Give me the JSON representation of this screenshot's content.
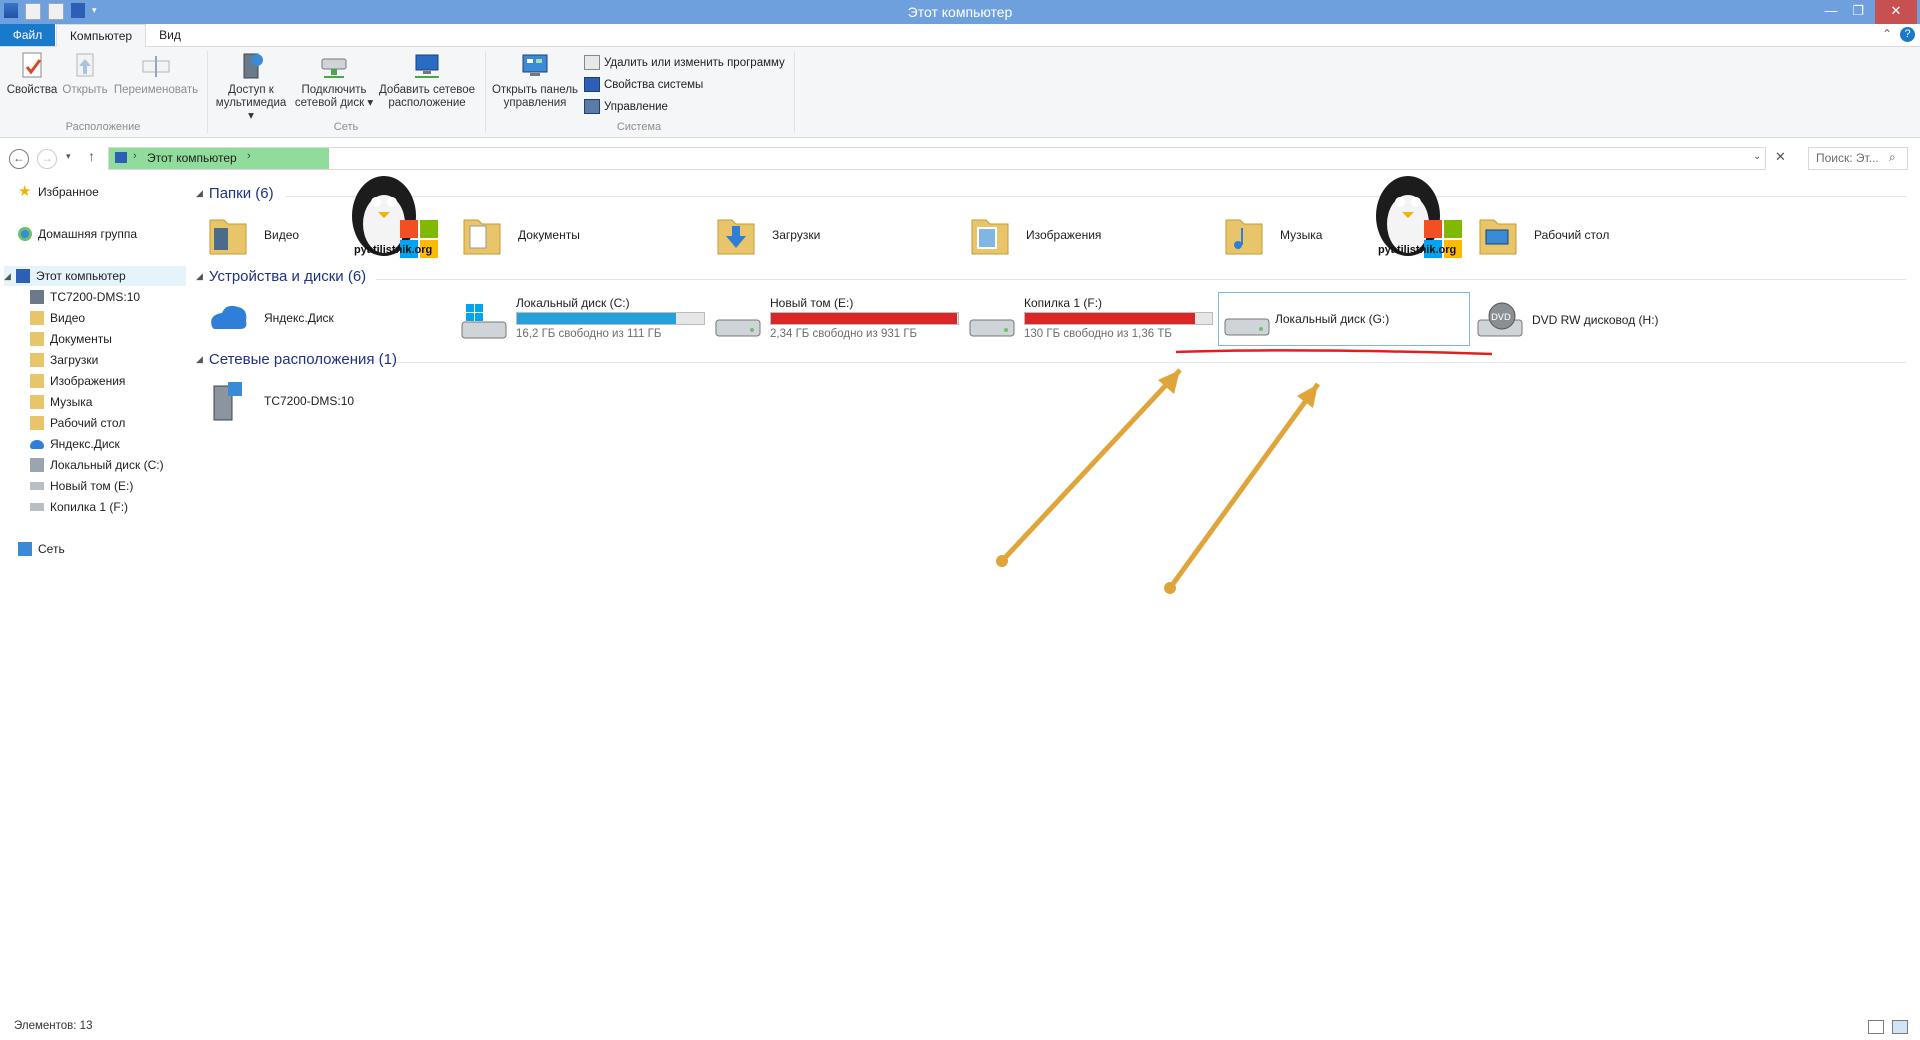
{
  "window": {
    "title": "Этот компьютер"
  },
  "ribbon": {
    "tabs": [
      "Файл",
      "Компьютер",
      "Вид"
    ],
    "location": {
      "label": "Расположение",
      "properties": "Свойства",
      "open": "Открыть",
      "rename": "Переименовать"
    },
    "network": {
      "label": "Сеть",
      "media_line1": "Доступ к",
      "media_line2": "мультимедиа",
      "map_line1": "Подключить",
      "map_line2": "сетевой диск",
      "add_line1": "Добавить сетевое",
      "add_line2": "расположение"
    },
    "system": {
      "label": "Система",
      "control_line1": "Открыть панель",
      "control_line2": "управления",
      "uninstall": "Удалить или изменить программу",
      "sysprops": "Свойства системы",
      "manage": "Управление"
    }
  },
  "address": {
    "path": "Этот компьютер",
    "search_placeholder": "Поиск: Эт..."
  },
  "nav": {
    "favorites": "Избранное",
    "homegroup": "Домашняя группа",
    "this_pc": "Этот компьютер",
    "children": [
      "TC7200-DMS:10",
      "Видео",
      "Документы",
      "Загрузки",
      "Изображения",
      "Музыка",
      "Рабочий стол",
      "Яндекс.Диск",
      "Локальный диск (C:)",
      "Новый том (E:)",
      "Копилка 1 (F:)"
    ],
    "network": "Сеть"
  },
  "folders_section": "Папки (6)",
  "folders": [
    "Видео",
    "Документы",
    "Загрузки",
    "Изображения",
    "Музыка",
    "Рабочий стол"
  ],
  "devices_section": "Устройства и диски (6)",
  "devices": {
    "yandex": "Яндекс.Диск",
    "c": {
      "name": "Локальный диск (C:)",
      "free": "16,2 ГБ свободно из 111 ГБ",
      "used_fraction": 0.85
    },
    "e": {
      "name": "Новый том (E:)",
      "free": "2,34 ГБ свободно из 931 ГБ",
      "used_fraction": 0.997
    },
    "f": {
      "name": "Копилка 1 (F:)",
      "free": "130 ГБ свободно из 1,36 ТБ",
      "used_fraction": 0.91
    },
    "g": {
      "name": "Локальный диск (G:)"
    },
    "h": {
      "name": "DVD RW дисковод (H:)"
    }
  },
  "network_section": "Сетевые расположения (1)",
  "network_items": [
    "TC7200-DMS:10"
  ],
  "watermark": "pyatilistnik.org",
  "status": {
    "items": "Элементов: 13"
  },
  "colors": {
    "accent": "#1979ca",
    "normal_bar": "#26a0da",
    "full_bar": "#da2626",
    "arrow": "#e0a53a",
    "underline": "#e02020"
  }
}
